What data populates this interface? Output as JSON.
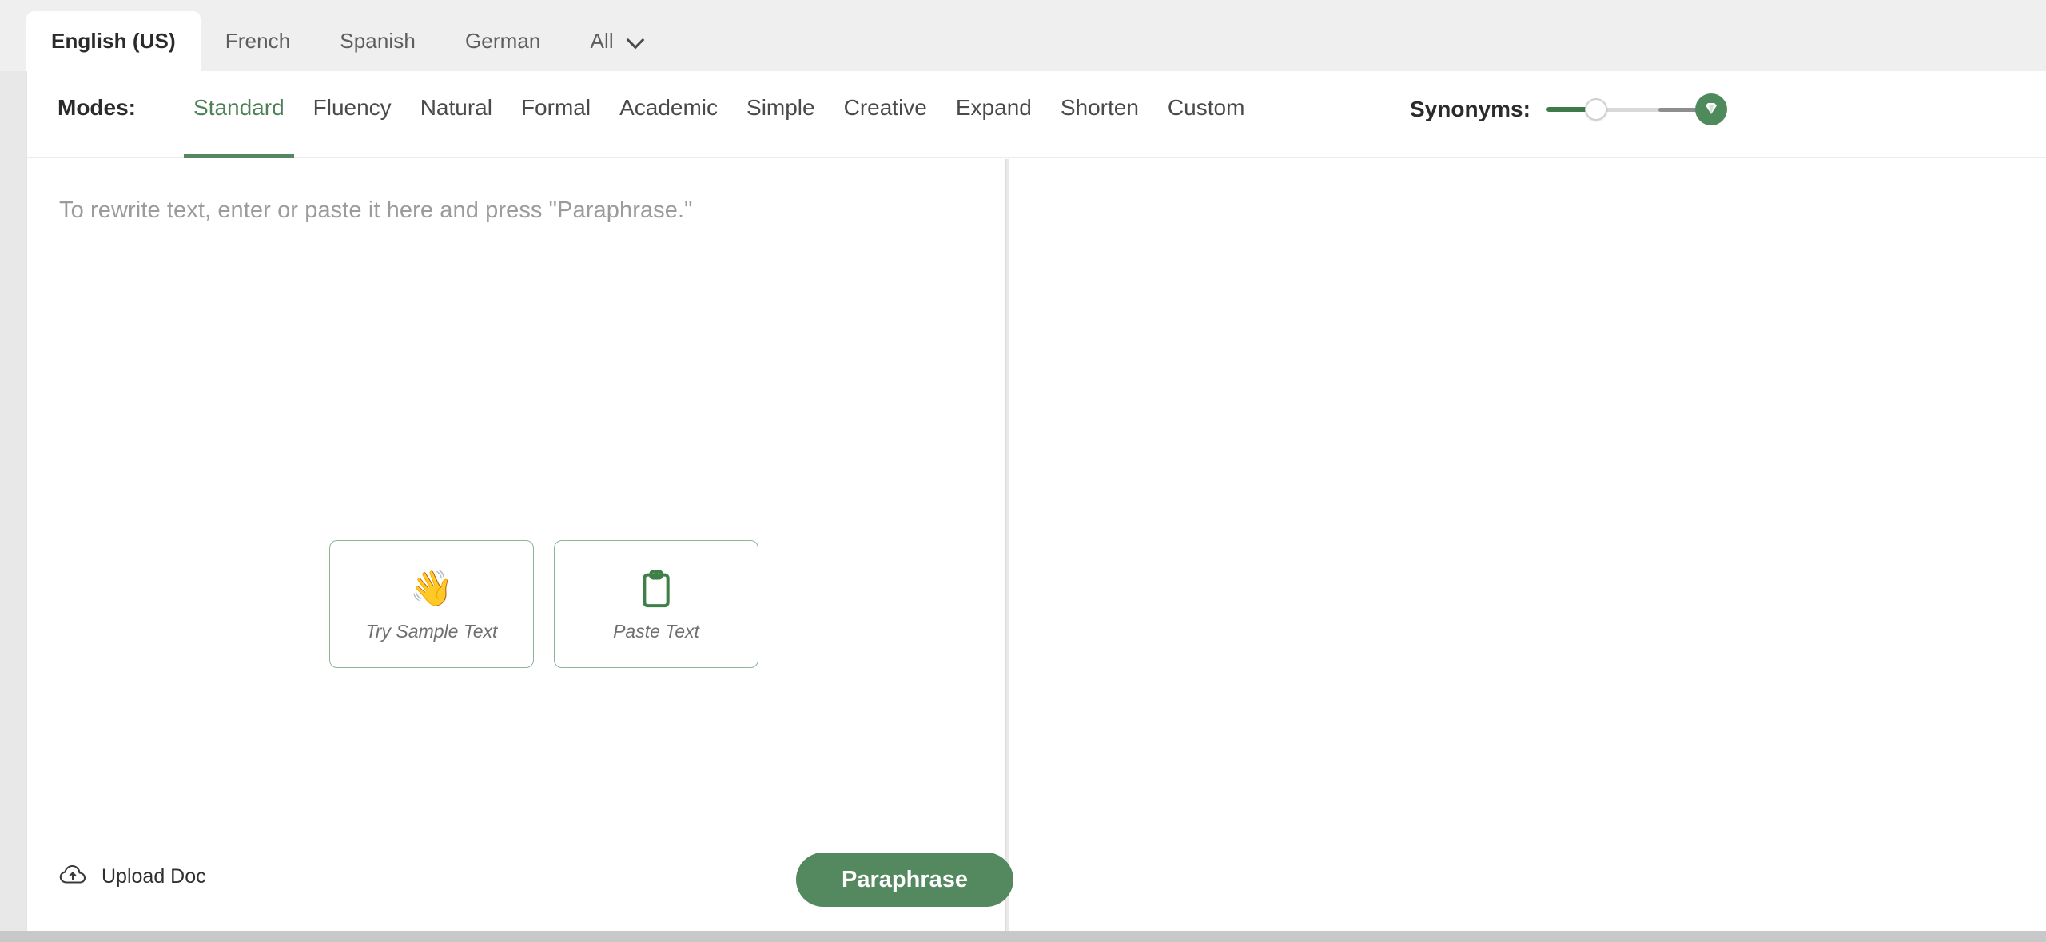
{
  "language_tabs": [
    {
      "label": "English (US)",
      "active": true
    },
    {
      "label": "French",
      "active": false
    },
    {
      "label": "Spanish",
      "active": false
    },
    {
      "label": "German",
      "active": false
    },
    {
      "label": "All",
      "active": false,
      "icon": "chevron-down-icon"
    }
  ],
  "modes": {
    "label": "Modes:",
    "items": [
      {
        "label": "Standard",
        "active": true
      },
      {
        "label": "Fluency",
        "active": false
      },
      {
        "label": "Natural",
        "active": false
      },
      {
        "label": "Formal",
        "active": false
      },
      {
        "label": "Academic",
        "active": false
      },
      {
        "label": "Simple",
        "active": false
      },
      {
        "label": "Creative",
        "active": false
      },
      {
        "label": "Expand",
        "active": false
      },
      {
        "label": "Shorten",
        "active": false
      },
      {
        "label": "Custom",
        "active": false
      }
    ]
  },
  "synonyms": {
    "label": "Synonyms:",
    "icon": "gem-icon",
    "value": 25
  },
  "editor": {
    "placeholder": "To rewrite text, enter or paste it here and press \"Paraphrase.\"",
    "value": "",
    "cards": [
      {
        "label": "Try Sample Text",
        "icon": "waving-hand-icon",
        "glyph": "👋"
      },
      {
        "label": "Paste Text",
        "icon": "clipboard-icon"
      }
    ]
  },
  "footer": {
    "upload_label": "Upload Doc",
    "upload_icon": "cloud-upload-icon",
    "paraphrase_label": "Paraphrase"
  },
  "output": {
    "content": ""
  },
  "colors": {
    "accent_green": "#54885f",
    "mode_active_green": "#4e8159",
    "card_border_green": "#8cb496",
    "tabbar_bg": "#efefef",
    "page_bg": "#e8e8e8"
  }
}
